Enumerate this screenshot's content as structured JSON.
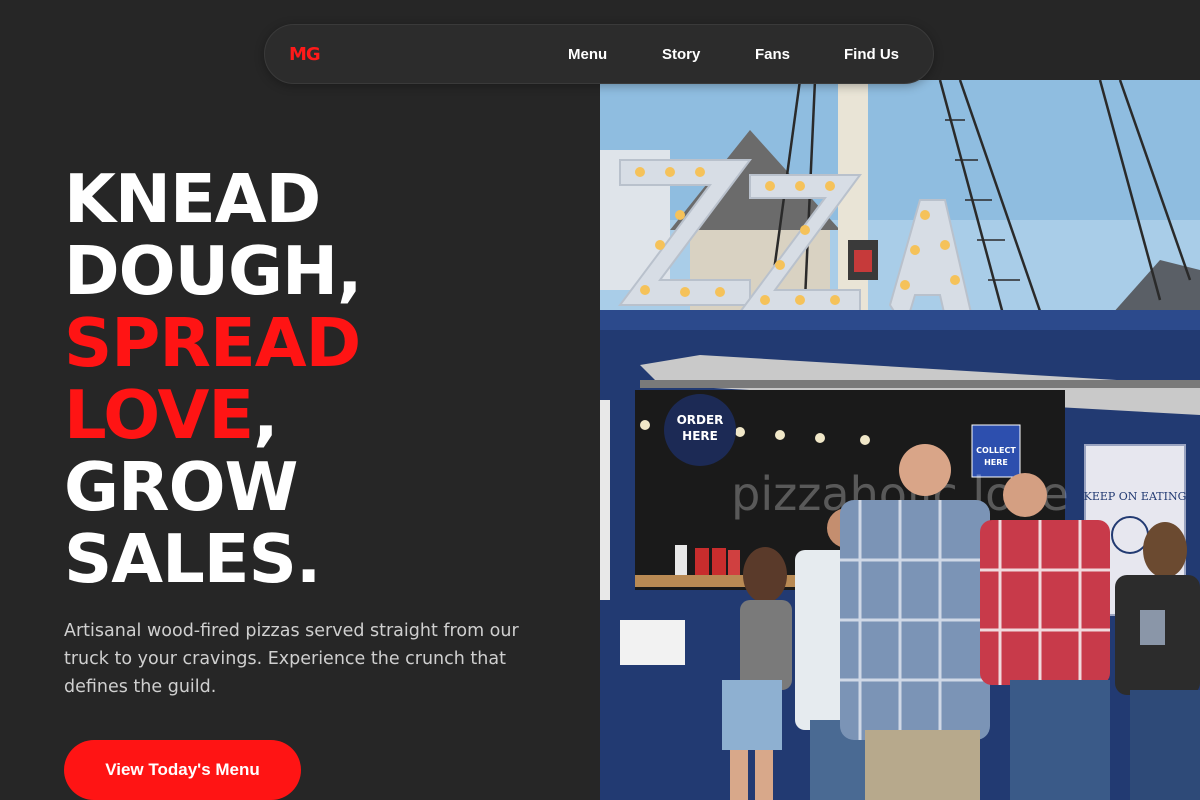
{
  "nav": {
    "logo": "MG",
    "links": [
      "Menu",
      "Story",
      "Fans",
      "Find Us"
    ]
  },
  "hero": {
    "headline": {
      "line1": "KNEAD",
      "line2": "DOUGH,",
      "line3": "SPREAD",
      "line4_red": "LOVE",
      "line4_rest": ",",
      "line5": "GROW",
      "line6": "SALES."
    },
    "subtext": "Artisanal wood-fired pizzas served straight from our truck to your cravings. Experience the crunch that defines the guild.",
    "cta_label": "View Today's Menu"
  },
  "photo": {
    "sign_text": "PIZZA",
    "order_badge": "ORDER HERE",
    "collect_badge": "COLLECT HERE",
    "poster_text": "KEEP ON EATING",
    "watermark": "pizzaholic.love"
  },
  "colors": {
    "background": "#262626",
    "nav_bg": "#2c2c2c",
    "accent": "#ff1414",
    "text": "#ffffff",
    "muted_text": "#cfcfcf"
  }
}
